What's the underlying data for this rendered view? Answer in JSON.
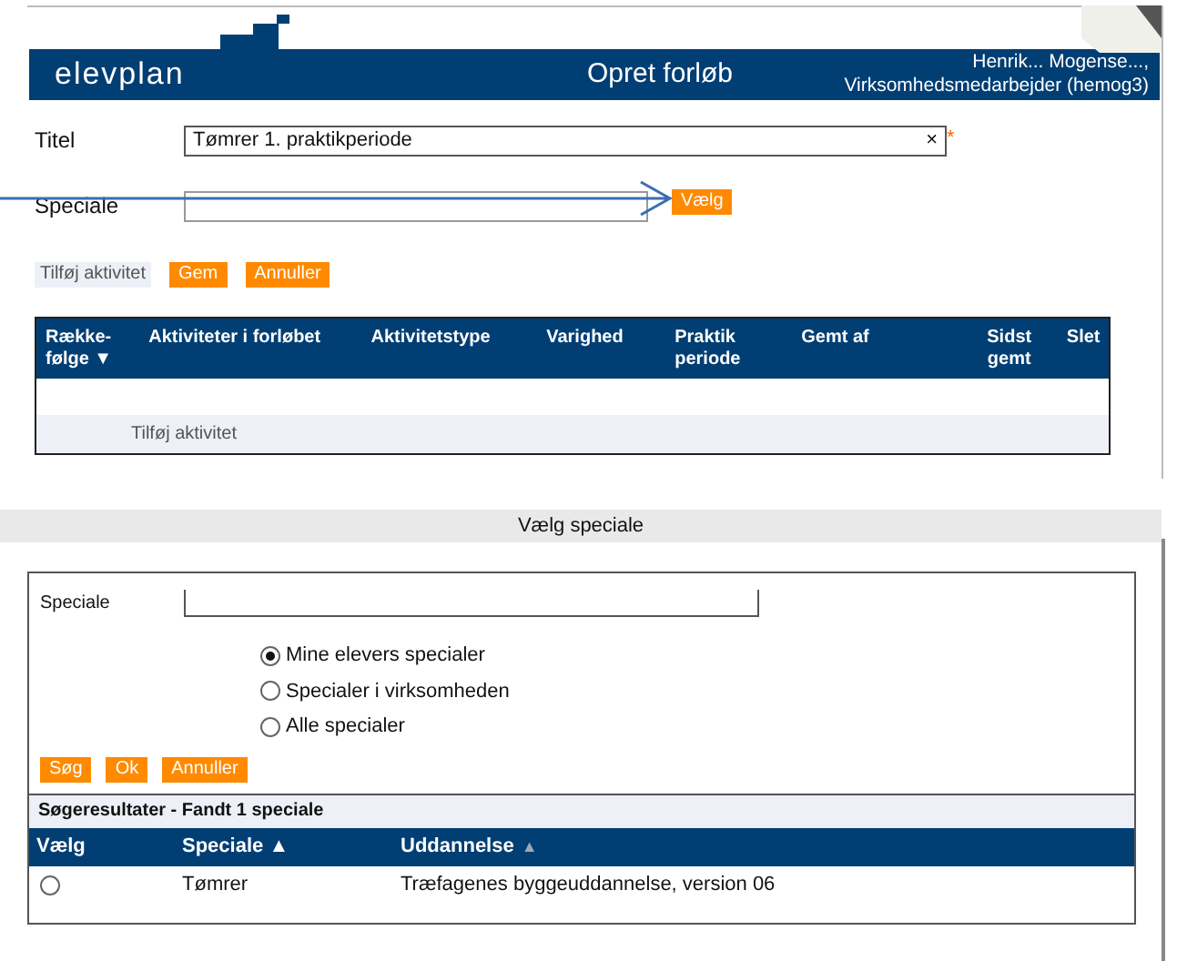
{
  "header": {
    "logo": "elevplan",
    "title": "Opret forløb",
    "user_lines": [
      "Henrik... Mogense...,",
      "Virksomhedsmedarbejder (hemog3)"
    ]
  },
  "form": {
    "title_label": "Titel",
    "title_value": "Tømrer 1. praktikperiode",
    "clear": "×",
    "required_mark": "*",
    "speciale_label": "Speciale",
    "choose_button": "Vælg"
  },
  "actions": [
    {
      "label": "Tilføj aktivitet",
      "kind": "plain"
    },
    {
      "label": "Gem",
      "kind": "orange"
    },
    {
      "label": "Annuller",
      "kind": "orange"
    }
  ],
  "activity_table": {
    "columns": [
      {
        "label": "Række-\nfølge ▼"
      },
      {
        "label": "Aktiviteter i forløbet"
      },
      {
        "label": "Aktivitetstype"
      },
      {
        "label": "Varighed"
      },
      {
        "label": "Praktik\nperiode"
      },
      {
        "label": "Gemt af"
      },
      {
        "label": "Sidst\ngemt"
      },
      {
        "label": "Slet"
      }
    ],
    "add_row": "Tilføj aktivitet"
  },
  "dialog": {
    "title": "Vælg speciale",
    "speciale_label": "Speciale",
    "scopes": [
      {
        "label": "Mine elevers specialer",
        "selected": true
      },
      {
        "label": "Specialer i virksomheden",
        "selected": false
      },
      {
        "label": "Alle specialer",
        "selected": false
      }
    ],
    "buttons": [
      "Søg",
      "Ok",
      "Annuller"
    ],
    "results_caption": "Søgeresultater - Fandt 1 speciale",
    "columns": [
      {
        "label": "Vælg"
      },
      {
        "label": "Speciale ▲"
      },
      {
        "label": "Uddannelse",
        "sort_mark": "▲"
      }
    ],
    "rows": [
      {
        "selected": false,
        "speciale": "Tømrer",
        "uddannelse": "Træfagenes byggeuddannelse, version 06"
      }
    ]
  }
}
